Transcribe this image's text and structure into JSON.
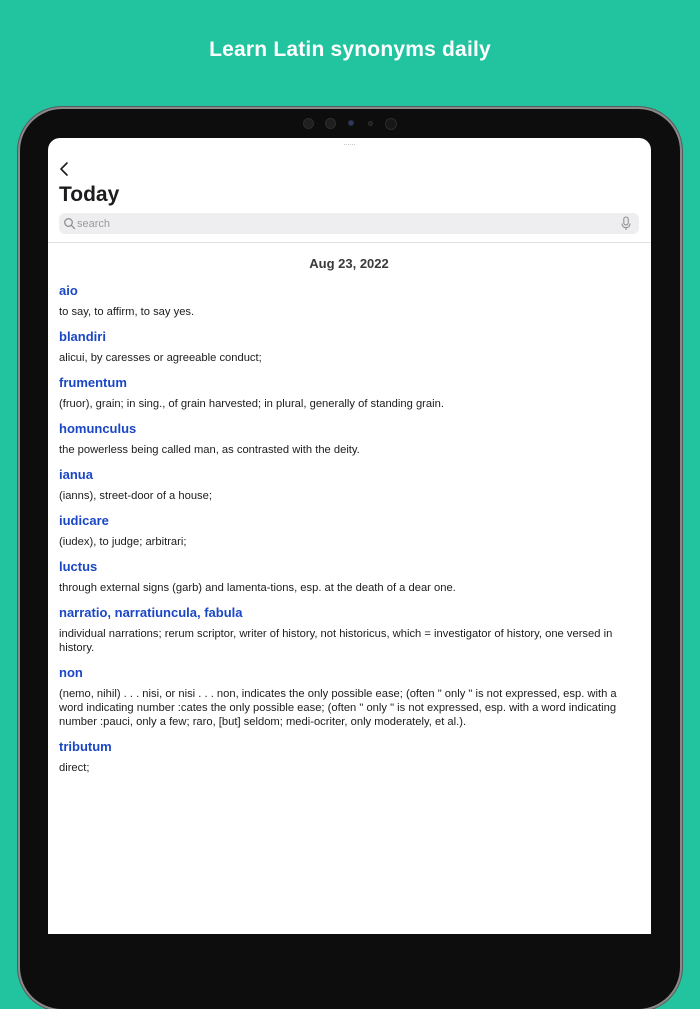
{
  "banner": {
    "title": "Learn Latin synonyms daily"
  },
  "nav": {
    "back_icon": "chevron-left-icon",
    "title": "Today"
  },
  "search": {
    "placeholder": "search",
    "value": "",
    "search_icon": "magnifier-icon",
    "mic_icon": "microphone-icon"
  },
  "content": {
    "date": "Aug 23, 2022",
    "entries": [
      {
        "word": "aio",
        "definition": "to say, to affirm, to say yes."
      },
      {
        "word": "blandiri",
        "definition": "alicui, by caresses or agreeable conduct;"
      },
      {
        "word": "frumentum",
        "definition": "(fruor), grain; in sing., of grain harvested; in plural, generally of standing grain."
      },
      {
        "word": "homunculus",
        "definition": "the powerless being called man, as contrasted with the deity."
      },
      {
        "word": "ianua",
        "definition": "(ianns), street-door of a house;"
      },
      {
        "word": "iudicare",
        "definition": "(iudex), to judge; arbitrari;"
      },
      {
        "word": "luctus",
        "definition": "through external signs (garb) and lamenta-tions, esp. at the death of a dear one."
      },
      {
        "word": "narratio, narratiuncula, fabula",
        "definition": "individual narrations; rerum scriptor, writer of history, not historicus, which = investigator of history, one versed in history."
      },
      {
        "word": "non",
        "definition": "(nemo, nihil) . . . nisi, or nisi . . . non, indicates the only possible ease; (often \" only \" is not expressed, esp. with a word indicating number :cates the only possible ease; (often \" only \" is not expressed, esp. with a word indicating number :pauci, only a few; raro, [but] seldom; medi-ocriter, only moderately, et al.)."
      },
      {
        "word": "tributum",
        "definition": "direct;"
      }
    ]
  },
  "colors": {
    "background": "#22c4a0",
    "word_link": "#1a47c5",
    "text": "#1c1c1e"
  }
}
